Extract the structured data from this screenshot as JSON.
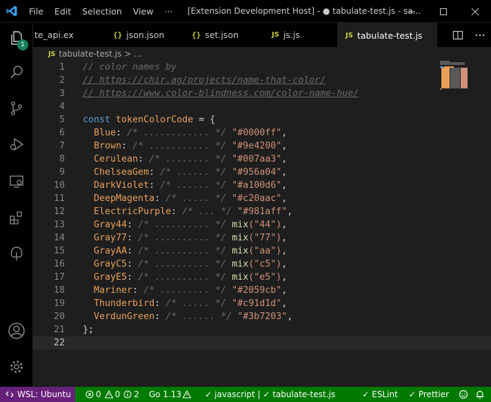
{
  "window": {
    "title": "[Extension Development Host] - ● tabulate-test.js - sa...",
    "menu": [
      "File",
      "Edit",
      "Selection",
      "View",
      "···"
    ]
  },
  "activity_bar": {
    "explorer_badge": "1",
    "icons": [
      "files-icon",
      "search-icon",
      "source-control-icon",
      "run-debug-icon",
      "remote-explorer-icon",
      "extensions-icon",
      "tree-icon",
      "account-icon",
      "gear-icon"
    ]
  },
  "tabs": [
    {
      "label": "te_api.ex",
      "icon": "",
      "active": false
    },
    {
      "label": "json.json",
      "icon": "{}",
      "active": false
    },
    {
      "label": "set.json",
      "icon": "{}",
      "active": false
    },
    {
      "label": "js.js",
      "icon": "JS",
      "active": false
    },
    {
      "label": "tabulate-test.js",
      "icon": "JS",
      "active": true,
      "dirty": true
    }
  ],
  "breadcrumb": {
    "file_icon": "JS",
    "file": "tabulate-test.js",
    "sep": ">",
    "more": "..."
  },
  "editor": {
    "current_line": "22",
    "lines": [
      {
        "n": "1"
      },
      {
        "n": "2"
      },
      {
        "n": "3"
      },
      {
        "n": "4"
      },
      {
        "n": "5"
      },
      {
        "n": "6"
      },
      {
        "n": "7"
      },
      {
        "n": "8"
      },
      {
        "n": "9"
      },
      {
        "n": "10"
      },
      {
        "n": "11"
      },
      {
        "n": "12"
      },
      {
        "n": "13"
      },
      {
        "n": "14"
      },
      {
        "n": "15"
      },
      {
        "n": "16"
      },
      {
        "n": "17"
      },
      {
        "n": "18"
      },
      {
        "n": "19"
      },
      {
        "n": "20"
      },
      {
        "n": "21"
      },
      {
        "n": "22"
      }
    ],
    "comment1": "// color names by",
    "comment2": "// https://chir.ag/projects/name-that-color/",
    "comment3": "// https://www.color-blindness.com/color-name-hue/",
    "kw_const": "const",
    "var_name": "tokenColorCode",
    "assign_open": " = {",
    "close": "};",
    "entries": [
      {
        "key": "Blue",
        "pad": "/* ............ */",
        "value": "\"#0000ff\"",
        "fn": ""
      },
      {
        "key": "Brown",
        "pad": "/* ........... */",
        "value": "\"#9e4200\"",
        "fn": ""
      },
      {
        "key": "Cerulean",
        "pad": "/* ........ */",
        "value": "\"#007aa3\"",
        "fn": ""
      },
      {
        "key": "ChelseaGem",
        "pad": "/* ...... */",
        "value": "\"#956a04\"",
        "fn": ""
      },
      {
        "key": "DarkViolet",
        "pad": "/* ...... */",
        "value": "\"#a100d6\"",
        "fn": ""
      },
      {
        "key": "DeepMagenta",
        "pad": "/* ..... */",
        "value": "\"#c20aac\"",
        "fn": ""
      },
      {
        "key": "ElectricPurple",
        "pad": "/* ... */",
        "value": "\"#981aff\"",
        "fn": ""
      },
      {
        "key": "Gray44",
        "pad": "/* .......... */",
        "value": "(\"44\")",
        "fn": "mix"
      },
      {
        "key": "Gray77",
        "pad": "/* .......... */",
        "value": "(\"77\")",
        "fn": "mix"
      },
      {
        "key": "GrayAA",
        "pad": "/* .......... */",
        "value": "(\"aa\")",
        "fn": "mix"
      },
      {
        "key": "GrayC5",
        "pad": "/* .......... */",
        "value": "(\"c5\")",
        "fn": "mix"
      },
      {
        "key": "GrayE5",
        "pad": "/* .......... */",
        "value": "(\"e5\")",
        "fn": "mix"
      },
      {
        "key": "Mariner",
        "pad": "/* ......... */",
        "value": "\"#2059cb\"",
        "fn": ""
      },
      {
        "key": "Thunderbird",
        "pad": "/* ..... */",
        "value": "\"#c91d1d\"",
        "fn": ""
      },
      {
        "key": "VerdunGreen",
        "pad": "/* ...... */",
        "value": "\"#3b7203\"",
        "fn": ""
      }
    ]
  },
  "status_bar": {
    "remote": "WSL: Ubuntu",
    "errors": "0",
    "warnings": "0",
    "infos": "2",
    "go_version": "Go 1.13",
    "language_check": "javascript | ✓ tabulate-test.js",
    "eslint": "ESLint",
    "prettier": "Prettier",
    "color": "#007a00",
    "remote_color": "#68217a"
  }
}
